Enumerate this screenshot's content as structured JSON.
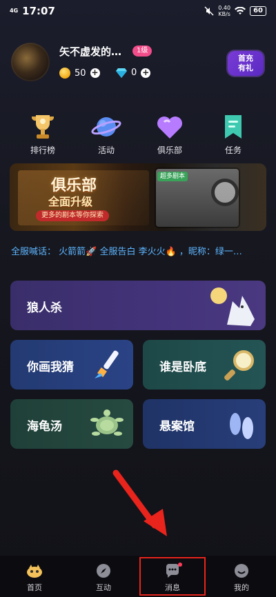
{
  "status_bar": {
    "network": "4G",
    "time": "17:07",
    "speed_value": "0.40",
    "speed_unit": "KB/s",
    "battery": "60"
  },
  "profile": {
    "username": "矢不虚发的…",
    "level": "1级",
    "coins": "50",
    "gems": "0",
    "promo_line1": "首充",
    "promo_line2": "有礼"
  },
  "quick_actions": [
    {
      "label": "排行榜",
      "icon": "trophy-icon"
    },
    {
      "label": "活动",
      "icon": "planet-icon"
    },
    {
      "label": "俱乐部",
      "icon": "heart-icon"
    },
    {
      "label": "任务",
      "icon": "task-icon"
    }
  ],
  "banner": {
    "title": "俱乐部",
    "subtitle": "全面升级",
    "strip_text": "更多的剧本等你探索",
    "book_tag": "超多剧本"
  },
  "announcement": "全服喊话： 火箭箭🚀 全服告白 李火火🔥 ，昵称：绿一…",
  "games": [
    {
      "label": "狼人杀",
      "icon": "werewolf-icon"
    },
    {
      "label": "你画我猜",
      "icon": "paintbrush-icon"
    },
    {
      "label": "谁是卧底",
      "icon": "magnifier-icon"
    },
    {
      "label": "海龟汤",
      "icon": "turtle-icon"
    },
    {
      "label": "悬案馆",
      "icon": "footprints-icon"
    }
  ],
  "bottom_nav": [
    {
      "label": "首页",
      "icon": "home-icon"
    },
    {
      "label": "互动",
      "icon": "compass-icon"
    },
    {
      "label": "消息",
      "icon": "message-icon"
    },
    {
      "label": "我的",
      "icon": "profile-icon"
    }
  ],
  "colors": {
    "accent_red": "#e8241c",
    "announce_blue": "#5eb6ff",
    "badge_pink": "#f14d8a"
  }
}
